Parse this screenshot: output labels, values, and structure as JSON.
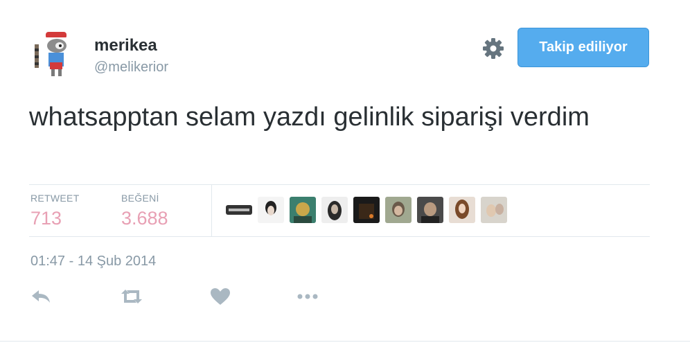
{
  "user": {
    "display_name": "merikea",
    "handle": "@melikerior"
  },
  "follow_button": {
    "label": "Takip ediliyor"
  },
  "tweet": {
    "text": "whatsapptan selam yazdı gelinlik siparişi verdim",
    "timestamp": "01:47 - 14 Şub 2014"
  },
  "stats": {
    "retweet_label": "RETWEET",
    "retweet_count": "713",
    "like_label": "BEĞENİ",
    "like_count": "3.688"
  },
  "icons": {
    "settings": "gear-icon",
    "reply": "reply-icon",
    "retweet": "retweet-icon",
    "like": "heart-icon",
    "more": "more-icon"
  },
  "colors": {
    "accent": "#55acee",
    "stat_value": "#e8a0b4",
    "muted": "#8899a6",
    "action_icon": "#aab8c2"
  }
}
